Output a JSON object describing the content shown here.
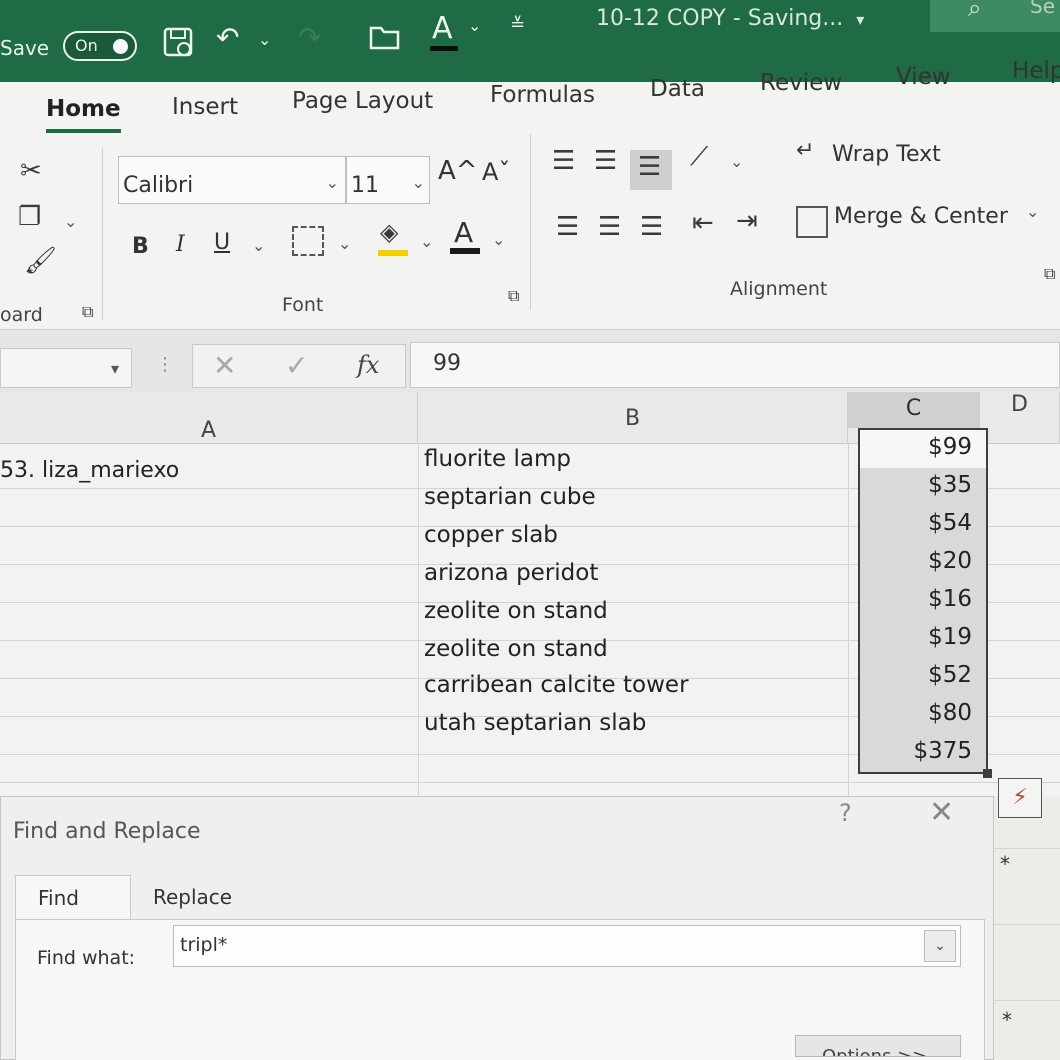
{
  "titlebar": {
    "autosave_label": "Save",
    "autosave_state": "On",
    "title": "10-12 COPY  -  Saving...",
    "title_caret": "▾",
    "search_text": "Se",
    "accent_color": "#1e6b45"
  },
  "tabs": [
    {
      "label": "Home",
      "active": true
    },
    {
      "label": "Insert"
    },
    {
      "label": "Page Layout"
    },
    {
      "label": "Formulas"
    },
    {
      "label": "Data"
    },
    {
      "label": "Review"
    },
    {
      "label": "View"
    },
    {
      "label": "Help"
    }
  ],
  "ribbon": {
    "clipboard_label": "oard",
    "font_group_label": "Font",
    "alignment_group_label": "Alignment",
    "font_name": "Calibri",
    "font_size": "11",
    "bold": "B",
    "italic": "I",
    "underline": "U",
    "grow_font": "A^",
    "shrink_font": "Aˇ",
    "font_color_glyph": "A",
    "wrap_text_label": "Wrap Text",
    "merge_center_label": "Merge & Center",
    "fill_color": "#f3d000"
  },
  "formula_bar": {
    "value": "99",
    "fx": "fx"
  },
  "sheet": {
    "columns": [
      "A",
      "B",
      "C",
      "D"
    ],
    "selected_column": "C",
    "cell_a1": "53. liza_mariexo",
    "items": [
      "fluorite lamp",
      "septarian cube",
      "copper slab",
      "arizona peridot",
      "zeolite on stand",
      "zeolite on stand",
      "carribean calcite tower",
      "utah septarian slab"
    ],
    "prices": [
      "$99",
      "$35",
      "$54",
      "$20",
      "$16",
      "$19",
      "$52",
      "$80",
      "$375"
    ]
  },
  "dialog": {
    "title": "Find and Replace",
    "help": "?",
    "close": "✕",
    "tab_find": "Find",
    "tab_replace": "Replace",
    "find_label": "Find what:",
    "find_value": "tripl*",
    "options_label": "Options >>",
    "asterisk_1": "*",
    "asterisk_2": "*"
  }
}
